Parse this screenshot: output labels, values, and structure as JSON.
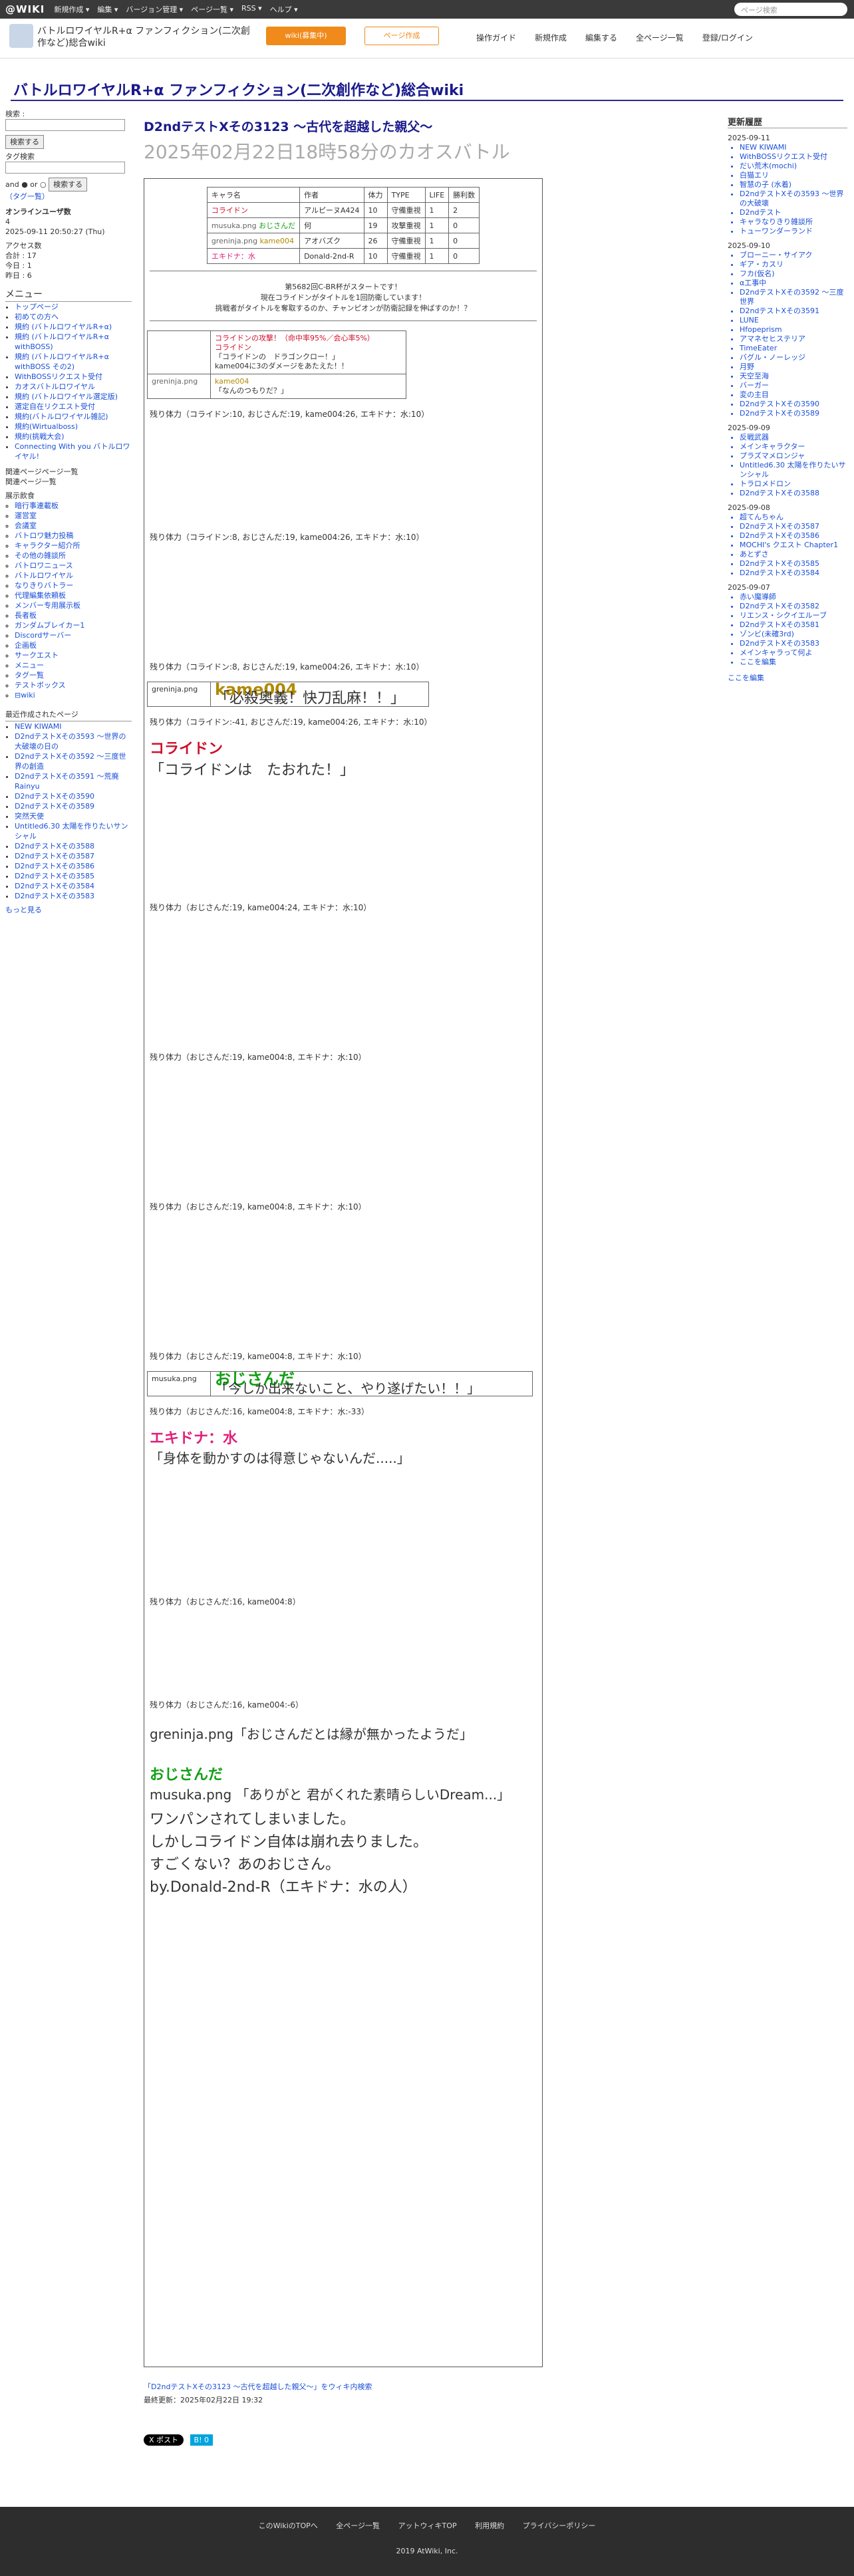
{
  "topbar": {
    "logo": "@WIKI",
    "menus": [
      "新規作成 ▾",
      "編集 ▾",
      "バージョン管理 ▾",
      "ページ一覧 ▾",
      "RSS ▾",
      "ヘルプ ▾"
    ],
    "search_placeholder": "ページ検索"
  },
  "subhead": {
    "site_name": "バトルロワイヤルR+α ファンフィクション(二次創作など)総合wiki",
    "member_btn": "wiki(募集中)",
    "edit_btn": "ページ作成",
    "nav": [
      "操作ガイド",
      "新規作成",
      "編集する",
      "全ページ一覧",
      "登録/ログイン"
    ]
  },
  "wiki_title": "バトルロワイヤルR+α ファンフィクション(二次創作など)総合wiki",
  "left": {
    "search_label": "検索 :",
    "search_btn": "検索する",
    "tag_label": "タグ検索",
    "radio_label": "and ● or ○",
    "tag_btn": "検索する",
    "tag_link": "（タグ一覧）",
    "online_head": "オンラインユーザ数",
    "online_count": "4",
    "online_time": "2025-09-11 20:50:27 (Thu)",
    "access_head": "アクセス数",
    "access": [
      "合計 : 17",
      "今日 : 1",
      "昨日 : 6"
    ],
    "menu_head": "メニュー",
    "menu_items": [
      "トップページ",
      "初めての方へ",
      "規約 (バトルロワイヤルR+α)",
      "規約 (バトルロワイヤルR+α withBOSS)",
      "規約 (バトルロワイヤルR+α withBOSS その2)",
      "WithBOSSリクエスト受付",
      "カオスバトルロワイヤル",
      "規約 (バトルロワイヤル選定版)",
      "選定自在リクエスト受付",
      "規約(バトルロワイヤル雑記)",
      "規約(Wirtualboss)",
      "規約(挑戦大会)",
      "Connecting With you バトルロワイヤル!"
    ],
    "tree_btns": [
      "関連ページページ一覧",
      "関連ページ一覧"
    ],
    "tree_head": "展示飲食",
    "tree_items": [
      "暗行事連載板",
      "運営室",
      "会議室",
      "バトロワ魅力投稿",
      "キャラクター紹介所",
      "その他の雑談所",
      "バトロワニュース",
      "バトルロワイヤル",
      "なりきりバトラー",
      "代理編集依頼板",
      "メンバー专用展示板",
      "長者板",
      "ガンダムブレイカー1",
      "Discordサーバー",
      "企画板",
      "サークエスト",
      "メニュー",
      "タグ一覧",
      "テストボックス",
      "⊟wiki"
    ],
    "recent_head": "最近作成されたページ",
    "recent_items": [
      "NEW KIWAMI",
      "D2ndテストXその3593 ～世界の大破壊の日の",
      "D2ndテストXその3592 ～三度世界の創造",
      "D2ndテストXその3591 ～荒廃 Rainyu",
      "D2ndテストXその3590",
      "D2ndテストXその3589",
      "突然天使",
      "Untitled6.30 太陽を作りたいサンシャル",
      "D2ndテストXその3588",
      "D2ndテストXその3587",
      "D2ndテストXその3586",
      "D2ndテストXその3585",
      "D2ndテストXその3584",
      "D2ndテストXその3583"
    ],
    "more_link": "もっと見る"
  },
  "right": {
    "head": "更新履歴",
    "groups": [
      {
        "date": "2025-09-11",
        "items": [
          "NEW KIWAMI",
          "WithBOSSリクエスト受付",
          "だい荒木(mochi)",
          "白猫エリ",
          "智慧の子 (水着)",
          "D2ndテストXその3593 ～世界の大破壊",
          "D2ndテスト",
          "キャラなりきり雑談所",
          "トューワンダーランド"
        ]
      },
      {
        "date": "2025-09-10",
        "items": [
          "ブローニー・サイアク",
          "ギア・カスリ",
          "フカ(仮名)",
          "α工事中",
          "D2ndテストXその3592 ～三度世界",
          "D2ndテストXその3591",
          "LUNE",
          "Hfopeprism",
          "アマネセヒステリア",
          "TimeEater",
          "バグル・ノーレッジ",
          "月野",
          "天空至海",
          "バーガー",
          "変の主目",
          "D2ndテストXその3590",
          "D2ndテストXその3589"
        ]
      },
      {
        "date": "2025-09-09",
        "items": [
          "反戦武器",
          "メインキャラクター",
          "プラズマメロンジャ",
          "Untitled6.30 太陽を作りたいサンシャル",
          "トラロメドロン",
          "D2ndテストXその3588"
        ]
      },
      {
        "date": "2025-09-08",
        "items": [
          "超てんちゃん",
          "D2ndテストXその3587",
          "D2ndテストXその3586",
          "MOCHI's クエスト Chapter1",
          "あとずさ",
          "D2ndテストXその3585",
          "D2ndテストXその3584"
        ]
      },
      {
        "date": "2025-09-07",
        "items": [
          "赤い魔導師",
          "D2ndテストXその3582",
          "リエンス・シクイエルーブ",
          "D2ndテストXその3581",
          "ゾンビ(未確3rd)",
          "D2ndテストXその3583",
          "メインキャラって何よ",
          "ここを編集"
        ]
      }
    ],
    "edit_link": "ここを編集"
  },
  "main": {
    "page_h2": "D2ndテストXその3123 ～古代を超越した親父～",
    "page_h1": "2025年02月22日18時58分のカオスバトル",
    "table_head": [
      "キャラ名",
      "作者",
      "体力",
      "TYPE",
      "LIFE",
      "勝利数"
    ],
    "table_rows": [
      [
        "コライドン",
        "アルピーヌA424",
        "10",
        "守備重視",
        "1",
        "2"
      ],
      [
        "おじさんだ",
        "何",
        "19",
        "攻撃重視",
        "1",
        "0"
      ],
      [
        "kame004",
        "アオバズク",
        "26",
        "守備重視",
        "1",
        "0"
      ],
      [
        "エキドナ：水",
        "Donald-2nd-R",
        "10",
        "守備重視",
        "1",
        "0"
      ]
    ],
    "img_musuka": "musuka.png",
    "img_greninja": "greninja.png",
    "notice": [
      "第5682回C-BR杯がスタートです！",
      "現在コライドンがタイトルを1回防衛しています！",
      "挑戦者がタイトルを奪取するのか、チャンピオンが防衛記録を伸ばすのか！？"
    ],
    "first_row": "コライドンの攻撃！（命中率95%／会心率5%）",
    "line2": "「コライドンの　ドラゴンクロー！」",
    "line3": "kame004に3のダメージをあたえた！！",
    "line4": "「なんのつもりだ？」",
    "rem1": "残り体力（コライドン:10, おじさんだ:19, kame004:26, エキドナ：水:10）",
    "rem2": "残り体力（コライドン:8, おじさんだ:19, kame004:26, エキドナ：水:10）",
    "rem3": "残り体力（コライドン:-41, おじさんだ:19, kame004:26, エキドナ：水:10）",
    "rem4": "残り体力（おじさんだ:19, kame004:24, エキドナ：水:10）",
    "rem5": "残り体力（おじさんだ:19, kame004:8, エキドナ：水:10）",
    "rem6": "残り体力（おじさんだ:16, kame004:8, エキドナ：水:-33）",
    "rem7": "残り体力（おじさんだ:16, kame004:8）",
    "rem8": "残り体力（おじさんだ:16, kame004:-6）",
    "big1": "kame004",
    "big1b": "「必殺奥義！快刀乱麻！！」",
    "fall1": "コライドン",
    "fall1b": "「コライドンは　たおれた！」",
    "big2": "おじさんだ",
    "big2b": "「今しか出来ないこと、やり遂げたい！！」",
    "fall2": "エキドナ：水",
    "fall2b": "「身体を動かすのは得意じゃないんだ.....」",
    "winner_line": "「おじさんだとは縁が無かったようだ」",
    "champion": "おじさんだ",
    "champion_quote": "「ありがと 君がくれた素晴らしいDream...」",
    "closing": [
      "ワンパンされてしまいました。",
      "しかしコライドン自体は崩れ去りました。",
      "すごくない？あのおじさん。",
      "by.Donald-2nd-R（エキドナ：水の人）"
    ]
  },
  "edit": {
    "link": "「D2ndテストXその3123 ～古代を超越した親父～」をウィキ内検索",
    "updated": "最終更新：2025年02月22日 19:32",
    "share": [
      "X ポスト",
      "B! 0"
    ]
  },
  "footer": {
    "links": [
      "このWikiのTOPへ",
      "全ページ一覧",
      "アットウィキTOP",
      "利用規約",
      "プライバシーポリシー"
    ],
    "copyright": "2019 AtWiki, Inc."
  }
}
